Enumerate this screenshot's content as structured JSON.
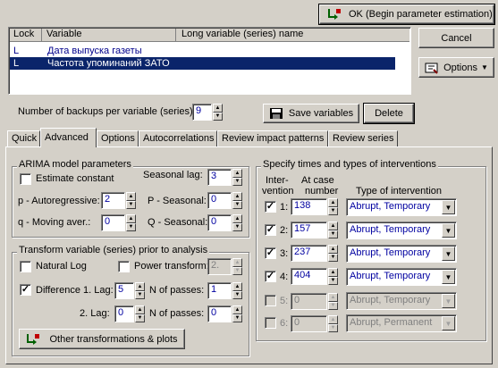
{
  "toolbar": {
    "ok_label": "OK (Begin parameter estimation)",
    "cancel_label": "Cancel",
    "options_label": "Options"
  },
  "var_table": {
    "headers": [
      "Lock",
      "Variable",
      "Long variable (series) name"
    ],
    "rows": [
      {
        "lock": "L",
        "variable": "Дата выпуска газеты",
        "long_name": "",
        "selected": false
      },
      {
        "lock": "L",
        "variable": "Частота упоминаний ЗАТО",
        "long_name": "",
        "selected": true
      }
    ]
  },
  "backups": {
    "label": "Number of backups per variable (series):",
    "value": "9"
  },
  "save_vars_label": "Save variables",
  "delete_label": "Delete",
  "tabs": [
    "Quick",
    "Advanced",
    "Options",
    "Autocorrelations",
    "Review impact patterns",
    "Review series"
  ],
  "active_tab": "Advanced",
  "arima": {
    "title": "ARIMA model parameters",
    "estimate_constant_label": "Estimate constant",
    "estimate_constant": false,
    "seasonal_lag_label": "Seasonal lag:",
    "seasonal_lag": "3",
    "p_label": "p - Autoregressive:",
    "p": "2",
    "P_label": "P - Seasonal:",
    "P": "0",
    "q_label": "q - Moving aver.:",
    "q": "0",
    "Q_label": "Q - Seasonal:",
    "Q": "0"
  },
  "transform": {
    "title": "Transform variable (series) prior to analysis",
    "natural_log_label": "Natural Log",
    "power_transform_label": "Power transform:",
    "power_value": "2.",
    "diff_label": "Difference 1. Lag:",
    "diff1_lag": "5",
    "npasses_label": "N of passes:",
    "diff1_passes": "1",
    "lag2_label": "2. Lag:",
    "diff2_lag": "0",
    "diff2_passes": "0",
    "other_label": "Other transformations & plots"
  },
  "interventions": {
    "title": "Specify times and types of interventions",
    "col1_line1": "Inter-",
    "col1_line2": "vention",
    "col2_line1": "At case",
    "col2_line2": "number",
    "col3": "Type of intervention",
    "rows": [
      {
        "num": "1:",
        "checked": true,
        "case": "138",
        "type": "Abrupt, Temporary",
        "enabled": true
      },
      {
        "num": "2:",
        "checked": true,
        "case": "157",
        "type": "Abrupt, Temporary",
        "enabled": true
      },
      {
        "num": "3:",
        "checked": true,
        "case": "237",
        "type": "Abrupt, Temporary",
        "enabled": true
      },
      {
        "num": "4:",
        "checked": true,
        "case": "404",
        "type": "Abrupt, Temporary",
        "enabled": true
      },
      {
        "num": "5:",
        "checked": false,
        "case": "0",
        "type": "Abrupt, Temporary",
        "enabled": false
      },
      {
        "num": "6:",
        "checked": false,
        "case": "0",
        "type": "Abrupt, Permanent",
        "enabled": false
      }
    ]
  }
}
